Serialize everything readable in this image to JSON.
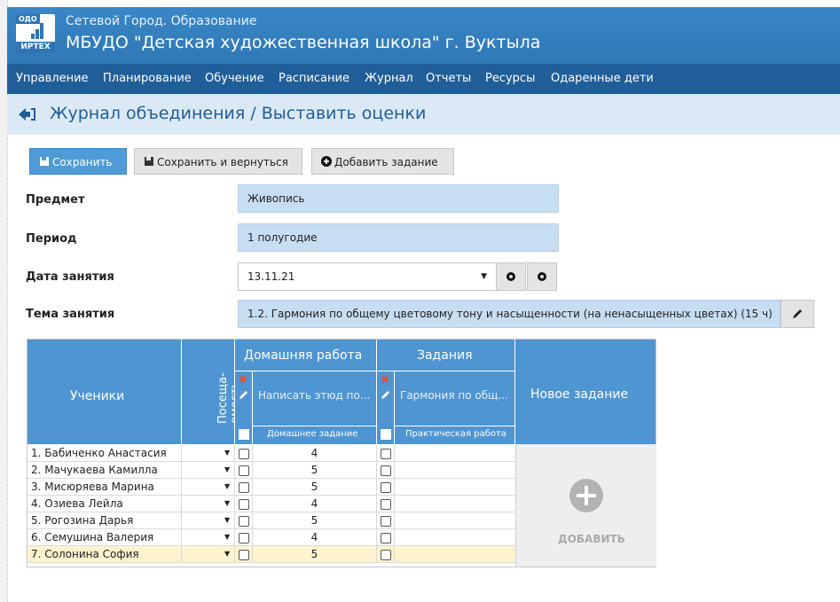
{
  "header": {
    "logo_badge": "ОДО",
    "logo_text": "ИРТЕХ",
    "subtitle": "Сетевой Город. Образование",
    "title": "МБУДО \"Детская художественная школа\" г. Вуктыла",
    "bg_color": "#3a86c6"
  },
  "menu": [
    "Управление",
    "Планирование",
    "Обучение",
    "Расписание",
    "Журнал",
    "Отчеты",
    "Ресурсы",
    "Одаренные дети"
  ],
  "page": {
    "back_icon": "back-arrow-icon",
    "title": "Журнал объединения / Выставить оценки"
  },
  "toolbar": {
    "save": "Сохранить",
    "save_return": "Сохранить и вернуться",
    "add_task": "Добавить задание"
  },
  "form": {
    "subject_label": "Предмет",
    "subject_value": "Живопись",
    "period_label": "Период",
    "period_value": "1 полугодие",
    "date_label": "Дата занятия",
    "date_value": "13.11.21",
    "topic_label": "Тема занятия",
    "topic_value": "1.2. Гармония по общему цветовому тону и насыщенности (на ненасыщенных цветах) (15 ч)"
  },
  "table": {
    "students_header": "Ученики",
    "attendance_header": "Посеща-емость",
    "homework_header": "Домашняя работа",
    "tasks_header": "Задания",
    "new_task_header": "Новое задание",
    "homework_col": {
      "title": "Написать этюд по...",
      "type": "Домашнее задание"
    },
    "task_col": {
      "title": "Гармония по общ...",
      "type": "Практическая работа"
    },
    "add_label": "ДОБАВИТЬ",
    "rows": [
      {
        "name": "1. Бабиченко Анастасия",
        "homework": "4",
        "task": ""
      },
      {
        "name": "2. Мачукаева Камилла",
        "homework": "5",
        "task": ""
      },
      {
        "name": "3. Мисюряева Марина",
        "homework": "5",
        "task": ""
      },
      {
        "name": "4. Озиева Лейла",
        "homework": "4",
        "task": ""
      },
      {
        "name": "5. Рогозина Дарья",
        "homework": "5",
        "task": ""
      },
      {
        "name": "6. Семушина Валерия",
        "homework": "4",
        "task": ""
      },
      {
        "name": "7. Солонина София",
        "homework": "5",
        "task": ""
      }
    ]
  },
  "colors": {
    "accent": "#4f95d1",
    "menu": "#1f5e99",
    "highlight_row": "#fdf3cf",
    "field": "#c7ddf1"
  }
}
